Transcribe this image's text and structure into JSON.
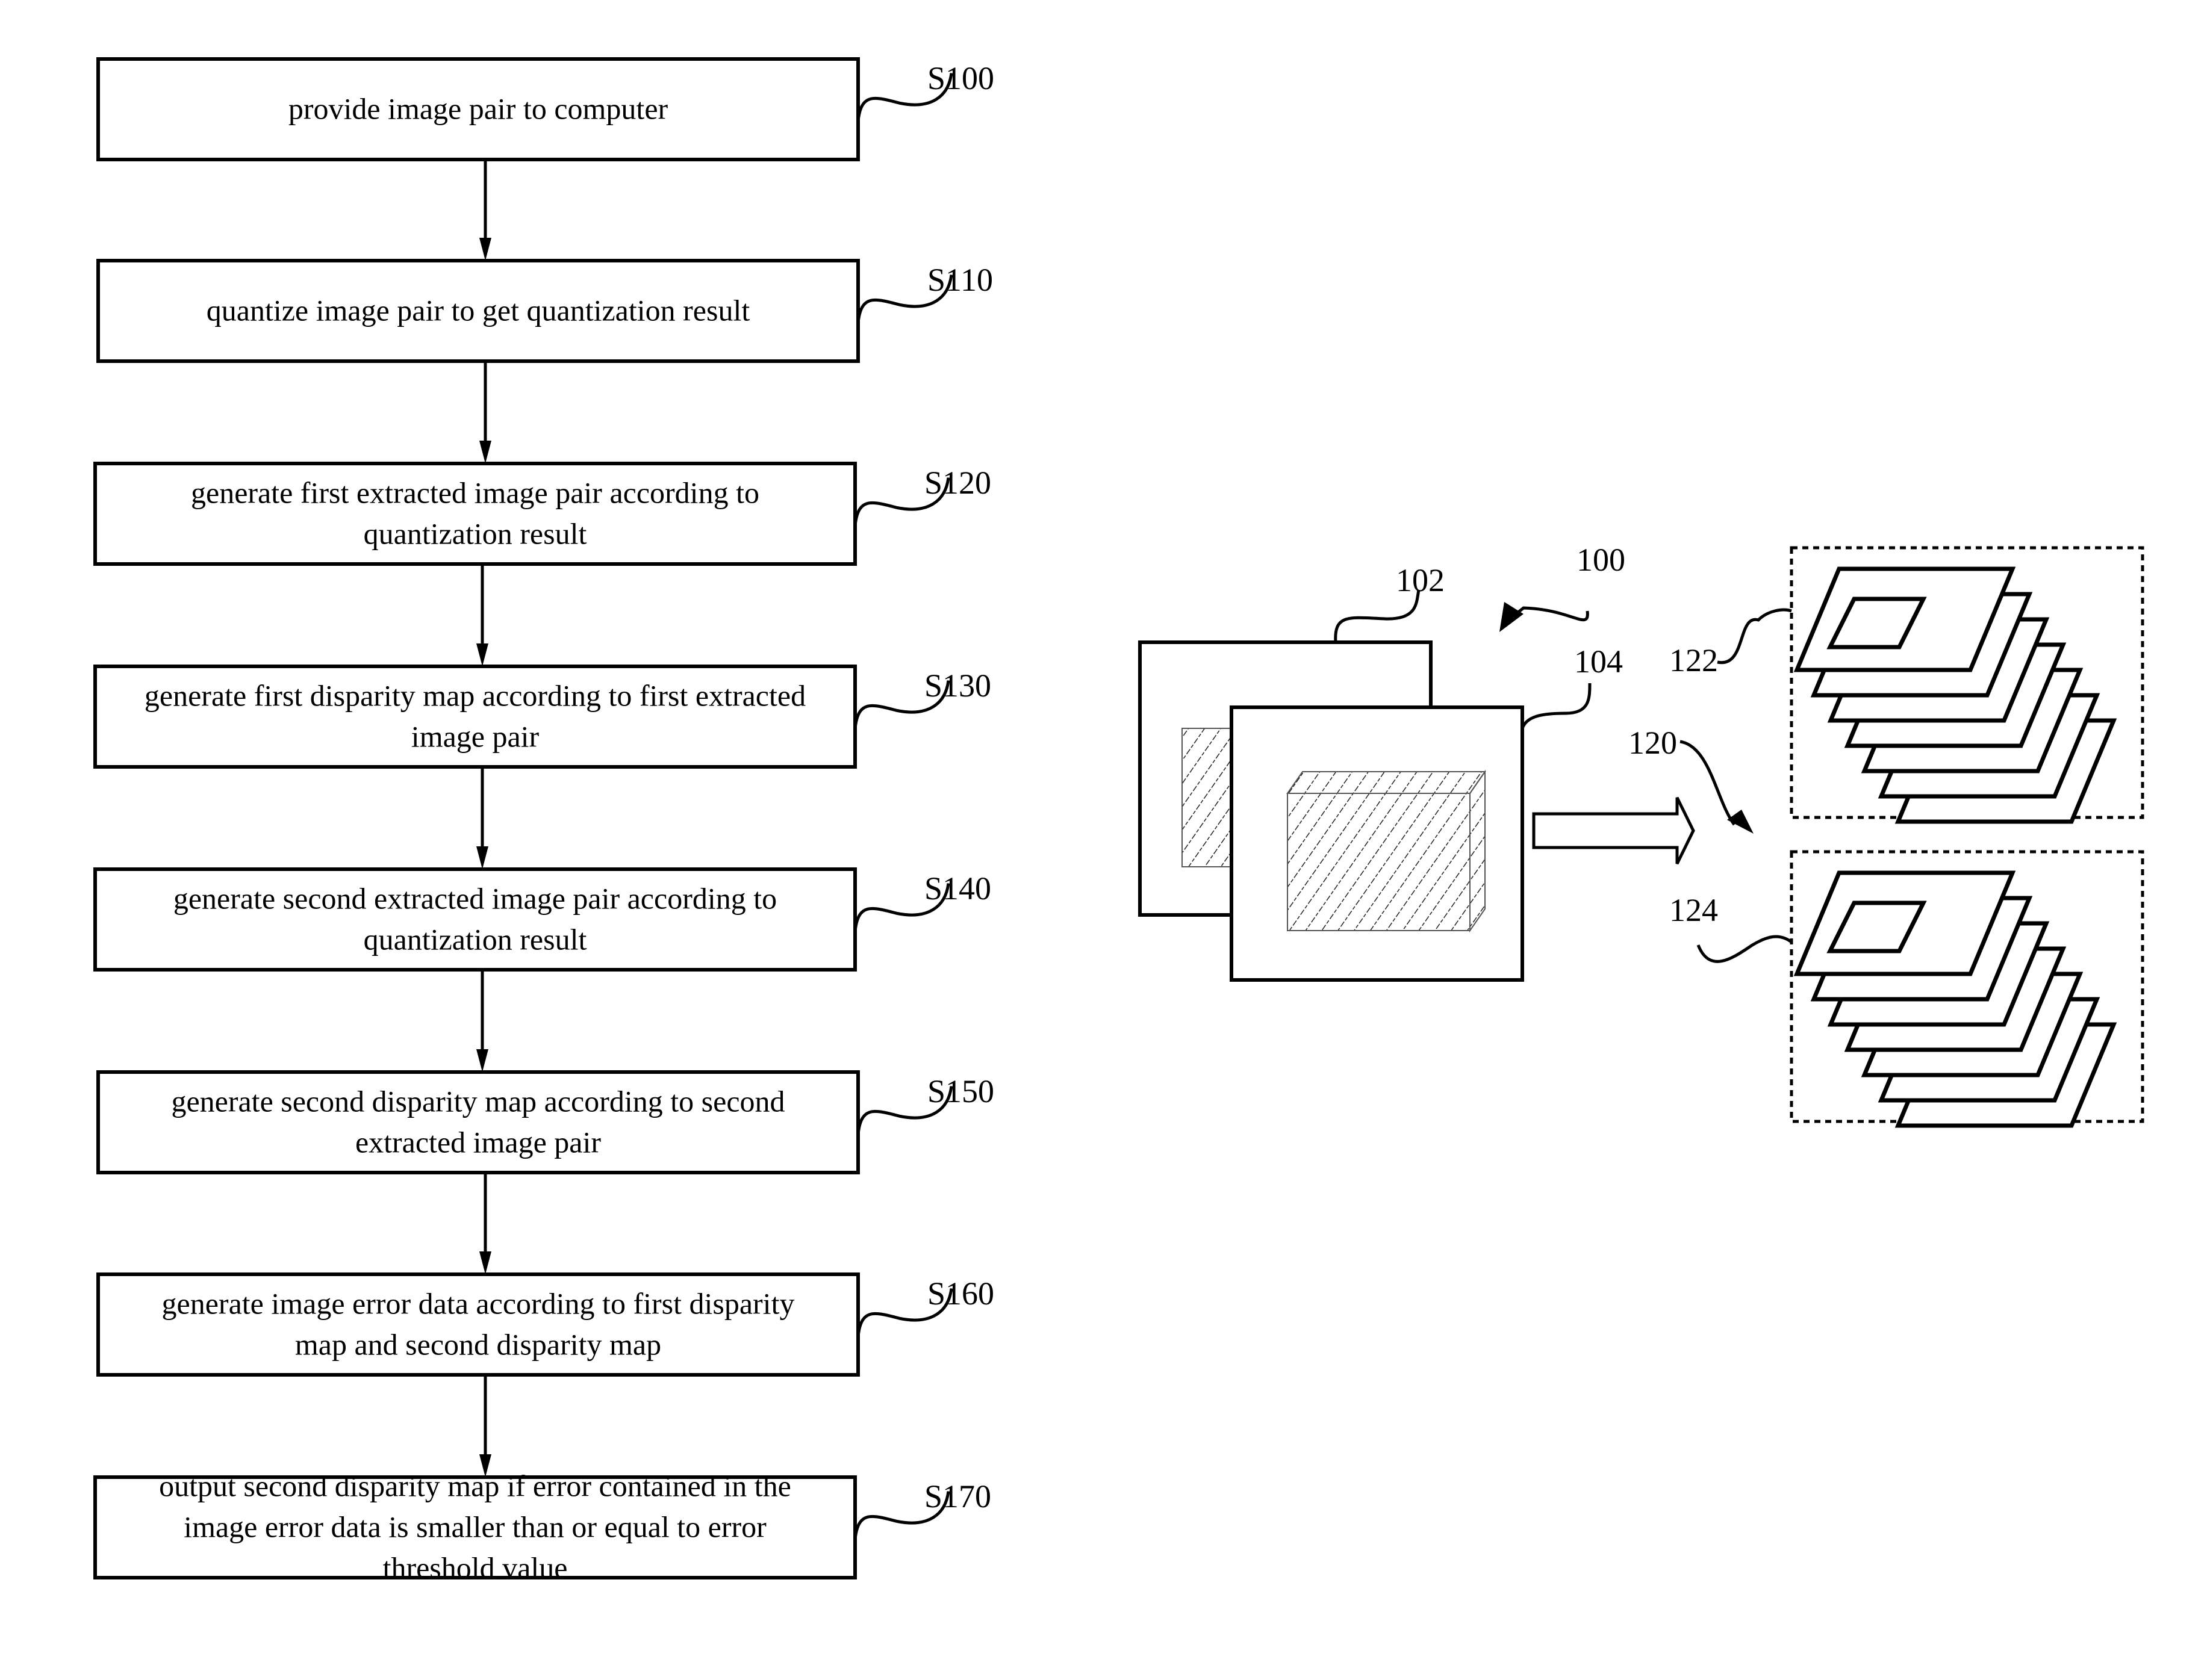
{
  "flowchart": {
    "steps": [
      {
        "id": "S100",
        "lines": [
          "provide image pair to computer"
        ]
      },
      {
        "id": "S110",
        "lines": [
          "quantize image pair to get quantization result"
        ]
      },
      {
        "id": "S120",
        "lines": [
          "generate first extracted image pair according to",
          "quantization result"
        ]
      },
      {
        "id": "S130",
        "lines": [
          "generate first disparity map according to first extracted",
          "image pair"
        ]
      },
      {
        "id": "S140",
        "lines": [
          "generate  second extracted image pair according to",
          "quantization result"
        ]
      },
      {
        "id": "S150",
        "lines": [
          "generate second disparity map according to second",
          "extracted image pair"
        ]
      },
      {
        "id": "S160",
        "lines": [
          "generate image error data according to first disparity",
          "map and second disparity map"
        ]
      },
      {
        "id": "S170",
        "lines": [
          "output second disparity map if error contained in the",
          "image error data is smaller than or equal to error",
          "threshold value"
        ]
      }
    ]
  },
  "figure": {
    "labels": {
      "system": "100",
      "first_image": "102",
      "second_image": "104",
      "output": "120",
      "first_stack": "122",
      "second_stack": "124"
    }
  }
}
